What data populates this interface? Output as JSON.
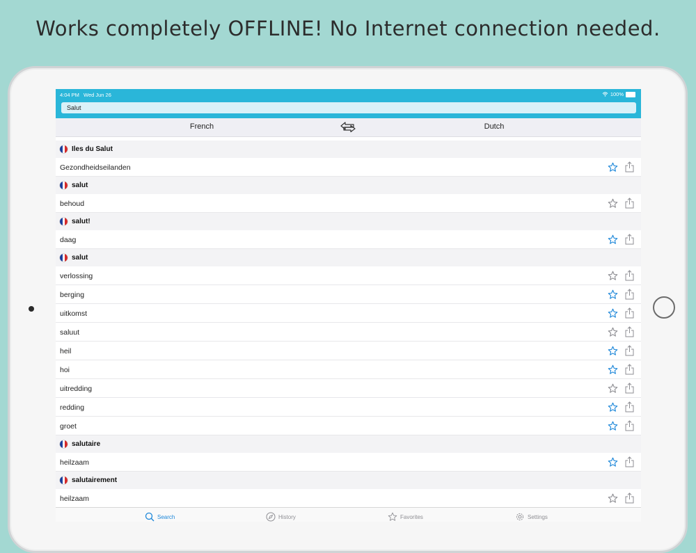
{
  "headline": "Works completely OFFLINE! No Internet connection needed.",
  "status_bar": {
    "time": "4:04 PM",
    "date": "Wed Jun 26",
    "battery": "100%"
  },
  "search": {
    "value": "Salut"
  },
  "languages": {
    "source": "French",
    "target": "Dutch"
  },
  "colors": {
    "accent": "#2ab6d9",
    "tab_active": "#1d87d9",
    "background": "#a3d8d2",
    "star_blue": "#1d87d9",
    "star_gray": "#8e8e93"
  },
  "results": [
    {
      "type": "header",
      "flag": "france-flag-icon",
      "word": "Iles du Salut"
    },
    {
      "type": "entry",
      "text": "Gezondheidseilanden",
      "favorite": true
    },
    {
      "type": "header",
      "flag": "france-flag-icon",
      "word": "salut"
    },
    {
      "type": "entry",
      "text": "behoud",
      "favorite": false
    },
    {
      "type": "header",
      "flag": "france-flag-icon",
      "word": "salut!"
    },
    {
      "type": "entry",
      "text": "daag",
      "favorite": true
    },
    {
      "type": "header",
      "flag": "france-flag-icon",
      "word": "salut"
    },
    {
      "type": "entry",
      "text": "verlossing",
      "favorite": false
    },
    {
      "type": "entry",
      "text": "berging",
      "favorite": true
    },
    {
      "type": "entry",
      "text": "uitkomst",
      "favorite": true
    },
    {
      "type": "entry",
      "text": "saluut",
      "favorite": false
    },
    {
      "type": "entry",
      "text": "heil",
      "favorite": true
    },
    {
      "type": "entry",
      "text": "hoi",
      "favorite": true
    },
    {
      "type": "entry",
      "text": "uitredding",
      "favorite": false
    },
    {
      "type": "entry",
      "text": "redding",
      "favorite": true
    },
    {
      "type": "entry",
      "text": "groet",
      "favorite": true
    },
    {
      "type": "header",
      "flag": "france-flag-icon",
      "word": "salutaire"
    },
    {
      "type": "entry",
      "text": "heilzaam",
      "favorite": true
    },
    {
      "type": "header",
      "flag": "france-flag-icon",
      "word": "salutairement"
    },
    {
      "type": "entry",
      "text": "heilzaam",
      "favorite": false
    }
  ],
  "tabs": [
    {
      "label": "Search",
      "icon": "search-icon",
      "active": true
    },
    {
      "label": "History",
      "icon": "compass-icon",
      "active": false
    },
    {
      "label": "Favorites",
      "icon": "star-icon",
      "active": false
    },
    {
      "label": "Settings",
      "icon": "gear-icon",
      "active": false
    }
  ]
}
